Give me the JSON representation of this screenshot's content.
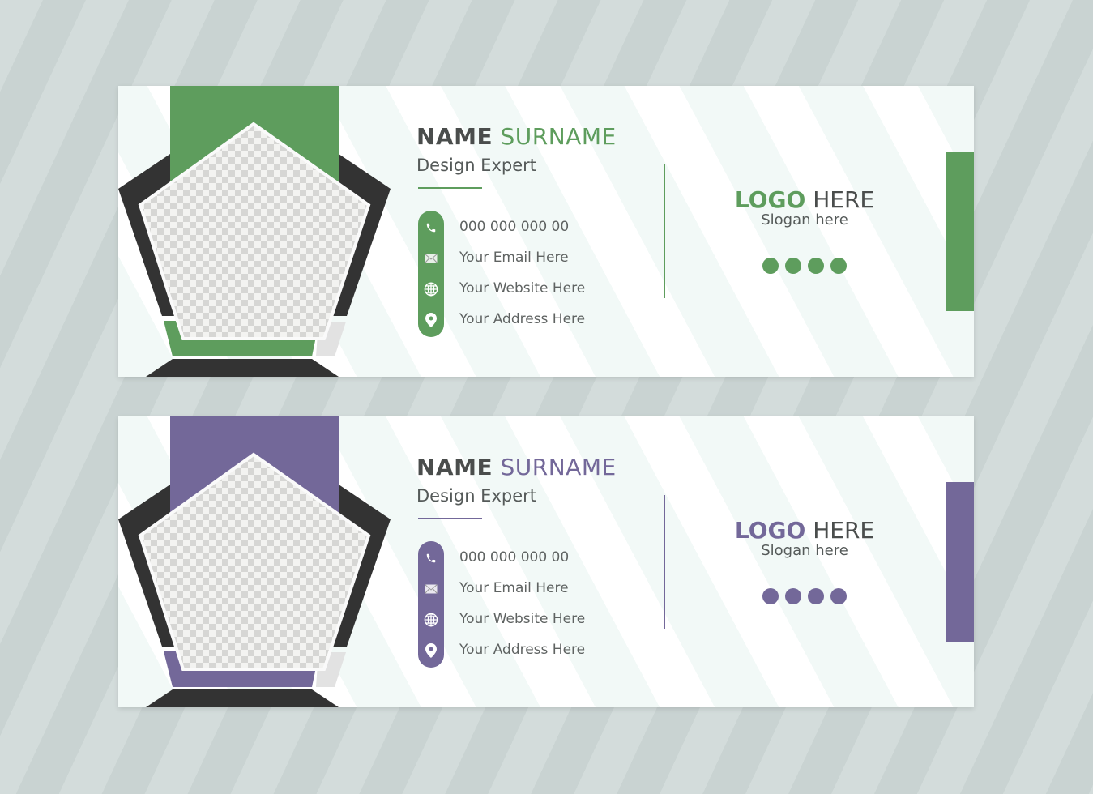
{
  "colors": {
    "dark": "#333333",
    "light_grey": "#e2e2e2",
    "text": "#555a59"
  },
  "cards": [
    {
      "accent": "#5e9d5d",
      "name_first": "NAME",
      "name_last": "SURNAME",
      "job_title": "Design Expert",
      "contacts": [
        {
          "icon": "phone-icon",
          "text": "000 000 000 00"
        },
        {
          "icon": "email-icon",
          "text": "Your Email Here"
        },
        {
          "icon": "globe-icon",
          "text": "Your Website Here"
        },
        {
          "icon": "location-pin-icon",
          "text": "Your Address Here"
        }
      ],
      "logo_bold": "LOGO",
      "logo_rest": "HERE",
      "slogan": "Slogan here",
      "social_dot_count": 4
    },
    {
      "accent": "#736899",
      "name_first": "NAME",
      "name_last": "SURNAME",
      "job_title": "Design Expert",
      "contacts": [
        {
          "icon": "phone-icon",
          "text": "000 000 000 00"
        },
        {
          "icon": "email-icon",
          "text": "Your Email Here"
        },
        {
          "icon": "globe-icon",
          "text": "Your Website Here"
        },
        {
          "icon": "location-pin-icon",
          "text": "Your Address Here"
        }
      ],
      "logo_bold": "LOGO",
      "logo_rest": "HERE",
      "slogan": "Slogan here",
      "social_dot_count": 4
    }
  ]
}
